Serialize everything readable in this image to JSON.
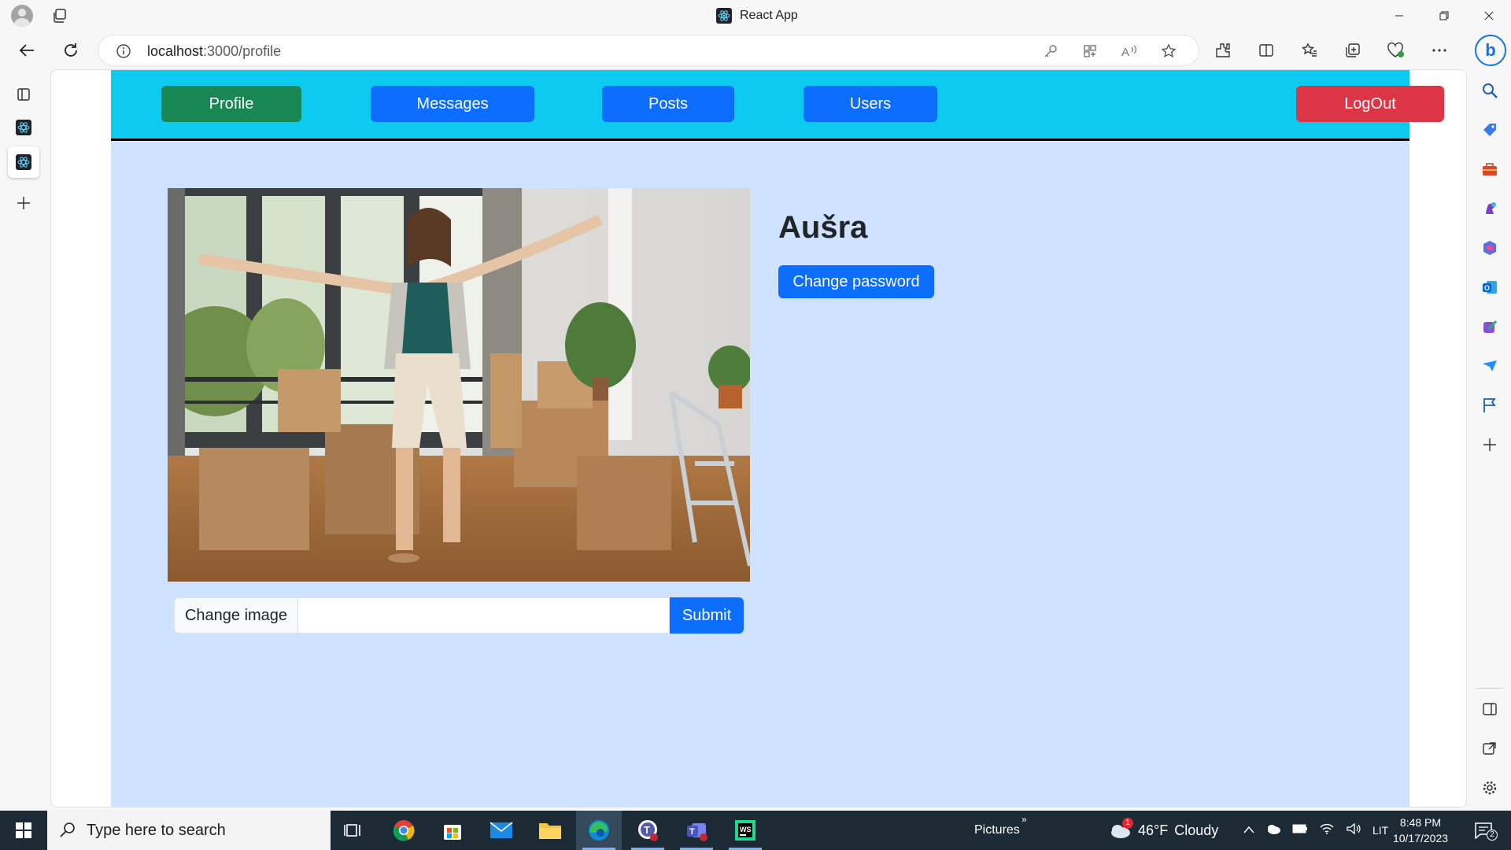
{
  "window": {
    "title": "React App"
  },
  "addressbar": {
    "host": "localhost",
    "path": ":3000/profile"
  },
  "nav": {
    "profile": "Profile",
    "messages": "Messages",
    "posts": "Posts",
    "users": "Users",
    "logout": "LogOut"
  },
  "profile": {
    "username": "Aušra",
    "change_password": "Change password",
    "change_image_label": "Change image",
    "image_url_value": "",
    "submit": "Submit"
  },
  "taskbar": {
    "search_placeholder": "Type here to search",
    "pictures_label": "Pictures",
    "weather_temp": "46°F",
    "weather_desc": "Cloudy",
    "weather_badge": "1",
    "language": "LIT",
    "time": "8:48 PM",
    "date": "10/17/2023",
    "notifications": "2"
  },
  "colors": {
    "nav_bg": "#0dcaf0",
    "page_bg": "#cfe2ff",
    "primary": "#0d6efd",
    "success": "#198754",
    "danger": "#dc3545"
  }
}
